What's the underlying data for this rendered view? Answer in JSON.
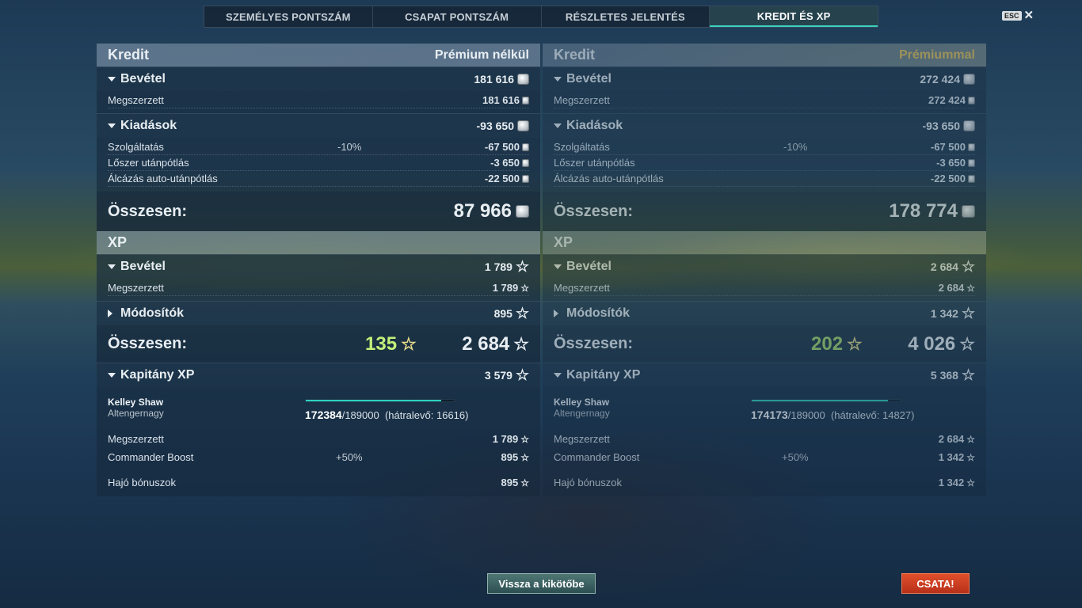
{
  "tabs": [
    "SZEMÉLYES PONTSZÁM",
    "CSAPAT PONTSZÁM",
    "RÉSZLETES JELENTÉS",
    "KREDIT ÉS XP"
  ],
  "active_tab": 3,
  "esc_label": "ESC",
  "panels": {
    "left": {
      "credit": {
        "title": "Kredit",
        "mode": "Prémium nélkül",
        "income": {
          "label": "Bevétel",
          "value": "181 616",
          "rows": [
            {
              "name": "Megszerzett",
              "pct": "",
              "value": "181 616"
            }
          ]
        },
        "expenses": {
          "label": "Kiadások",
          "value": "-93 650",
          "rows": [
            {
              "name": "Szolgáltatás",
              "pct": "-10%",
              "value": "-67 500"
            },
            {
              "name": "Lőszer utánpótlás",
              "pct": "",
              "value": "-3 650"
            },
            {
              "name": "Álcázás auto-utánpótlás",
              "pct": "",
              "value": "-22 500"
            }
          ]
        },
        "total_label": "Összesen:",
        "total_value": "87 966"
      },
      "xp": {
        "title": "XP",
        "income": {
          "label": "Bevétel",
          "value": "1 789",
          "rows": [
            {
              "name": "Megszerzett",
              "value": "1 789"
            }
          ]
        },
        "modifiers": {
          "label": "Módosítók",
          "value": "895"
        },
        "total_label": "Összesen:",
        "total_bonus": "135",
        "total_value": "2 684"
      },
      "captain": {
        "label": "Kapitány XP",
        "value": "3 579",
        "name": "Kelley Shaw",
        "rank": "Altengernagy",
        "xp_current": "172384",
        "xp_target": "/189000",
        "xp_remaining": "(hátralevő: 16616)",
        "progress_fraction": 0.912,
        "rows": [
          {
            "name": "Megszerzett",
            "pct": "",
            "value": "1 789"
          },
          {
            "name": "Commander Boost",
            "pct": "+50%",
            "value": "895"
          }
        ],
        "ship_bonus": {
          "name": "Hajó bónuszok",
          "value": "895"
        }
      }
    },
    "right": {
      "credit": {
        "title": "Kredit",
        "mode": "Prémiummal",
        "income": {
          "label": "Bevétel",
          "value": "272 424",
          "rows": [
            {
              "name": "Megszerzett",
              "pct": "",
              "value": "272 424"
            }
          ]
        },
        "expenses": {
          "label": "Kiadások",
          "value": "-93 650",
          "rows": [
            {
              "name": "Szolgáltatás",
              "pct": "-10%",
              "value": "-67 500"
            },
            {
              "name": "Lőszer utánpótlás",
              "pct": "",
              "value": "-3 650"
            },
            {
              "name": "Álcázás auto-utánpótlás",
              "pct": "",
              "value": "-22 500"
            }
          ]
        },
        "total_label": "Összesen:",
        "total_value": "178 774"
      },
      "xp": {
        "title": "XP",
        "income": {
          "label": "Bevétel",
          "value": "2 684",
          "rows": [
            {
              "name": "Megszerzett",
              "value": "2 684"
            }
          ]
        },
        "modifiers": {
          "label": "Módosítók",
          "value": "1 342"
        },
        "total_label": "Összesen:",
        "total_bonus": "202",
        "total_value": "4 026"
      },
      "captain": {
        "label": "Kapitány XP",
        "value": "5 368",
        "name": "Kelley Shaw",
        "rank": "Altengernagy",
        "xp_current": "174173",
        "xp_target": "/189000",
        "xp_remaining": "(hátralevő: 14827)",
        "progress_fraction": 0.922,
        "rows": [
          {
            "name": "Megszerzett",
            "pct": "",
            "value": "2 684"
          },
          {
            "name": "Commander Boost",
            "pct": "+50%",
            "value": "1 342"
          }
        ],
        "ship_bonus": {
          "name": "Hajó bónuszok",
          "value": "1 342"
        }
      }
    }
  },
  "buttons": {
    "back": "Vissza a kikötőbe",
    "battle": "CSATA!"
  },
  "colors": {
    "accent": "#2ed1c0",
    "premium": "#e6c45a",
    "bonus_xp": "#c2f07a",
    "battle_button": "#d0401f"
  }
}
